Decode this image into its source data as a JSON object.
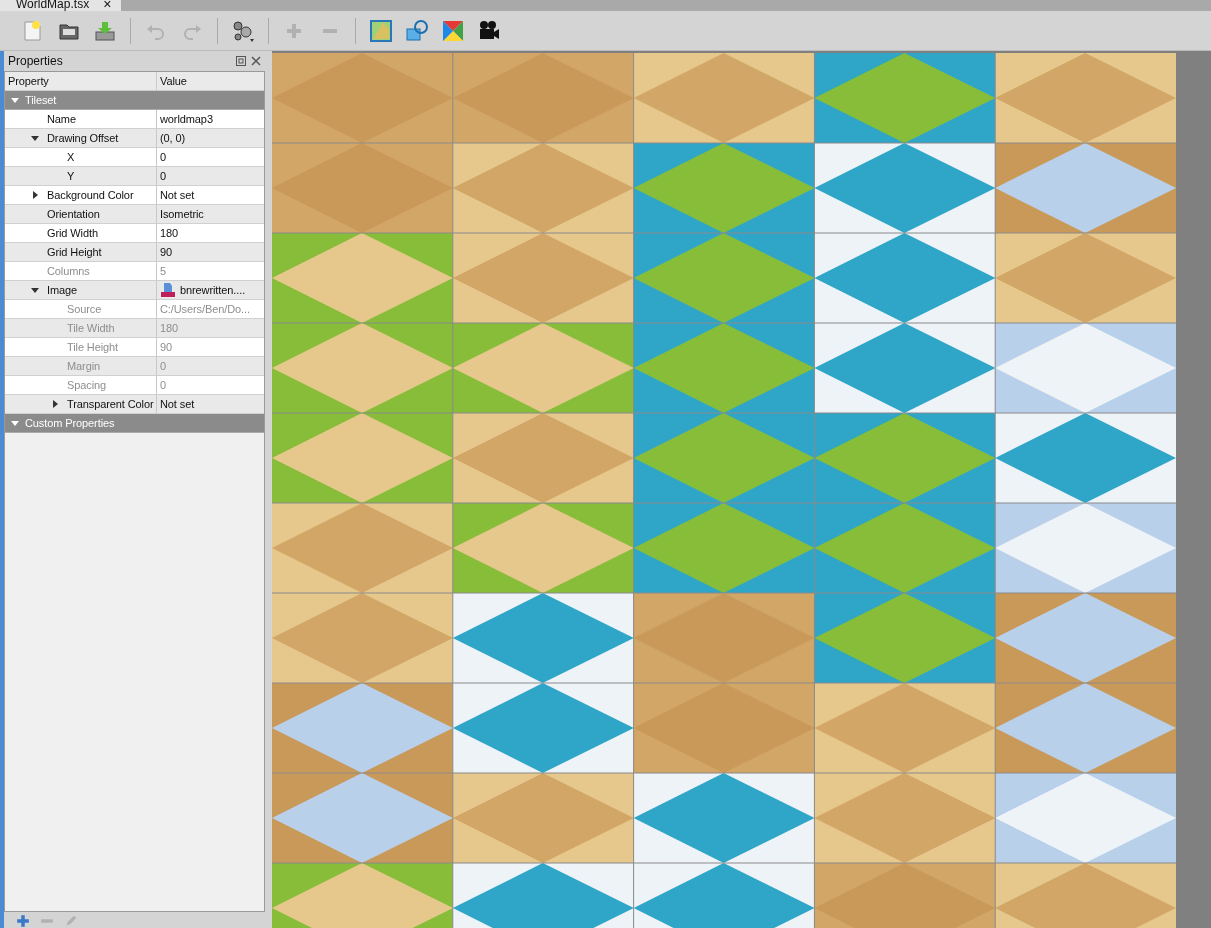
{
  "tab": {
    "title": "WorldMap.tsx",
    "close": "×"
  },
  "toolbar": [
    {
      "kind": "new",
      "disabled": false
    },
    {
      "kind": "open",
      "disabled": false
    },
    {
      "kind": "save",
      "disabled": false
    },
    {
      "kind": "undo",
      "disabled": true
    },
    {
      "kind": "redo",
      "disabled": true
    },
    {
      "kind": "gear",
      "disabled": false
    },
    {
      "kind": "add",
      "disabled": true
    },
    {
      "kind": "remove",
      "disabled": true
    },
    {
      "kind": "image",
      "disabled": false
    },
    {
      "kind": "shapes",
      "disabled": false
    },
    {
      "kind": "color",
      "disabled": false
    },
    {
      "kind": "camera",
      "disabled": false
    }
  ],
  "properties": {
    "title": "Properties",
    "columns": [
      "Property",
      "Value"
    ],
    "rows": [
      {
        "kind": "group",
        "label": "Tileset",
        "expanded": true,
        "children": [
          {
            "kind": "property",
            "label": "Name",
            "value": "worldmap3",
            "disabled": false
          },
          {
            "kind": "property",
            "label": "Drawing Offset",
            "value": "(0, 0)",
            "disabled": false,
            "expanded": true,
            "children": [
              {
                "kind": "property",
                "label": "X",
                "value": "0",
                "disabled": false
              },
              {
                "kind": "property",
                "label": "Y",
                "value": "0",
                "disabled": false
              }
            ]
          },
          {
            "kind": "property",
            "label": "Background Color",
            "value": "Not set",
            "disabled": false,
            "expanded": false
          },
          {
            "kind": "property",
            "label": "Orientation",
            "value": "Isometric",
            "disabled": false
          },
          {
            "kind": "property",
            "label": "Grid Width",
            "value": "180",
            "disabled": false
          },
          {
            "kind": "property",
            "label": "Grid Height",
            "value": "90",
            "disabled": false
          },
          {
            "kind": "property",
            "label": "Columns",
            "value": "5",
            "disabled": true
          },
          {
            "kind": "file",
            "label": "Image",
            "value": "bnrewritten....",
            "disabled": false,
            "expanded": true,
            "children": [
              {
                "kind": "property",
                "label": "Source",
                "value": "C:/Users/Ben/Do...",
                "disabled": true
              },
              {
                "kind": "property",
                "label": "Tile Width",
                "value": "180",
                "disabled": true
              },
              {
                "kind": "property",
                "label": "Tile Height",
                "value": "90",
                "disabled": true
              },
              {
                "kind": "property",
                "label": "Margin",
                "value": "0",
                "disabled": true
              },
              {
                "kind": "property",
                "label": "Spacing",
                "value": "0",
                "disabled": true
              },
              {
                "kind": "property",
                "label": "Transparent Color",
                "value": "Not set",
                "disabled": false,
                "expanded": false
              }
            ]
          }
        ]
      },
      {
        "kind": "group",
        "label": "Custom Properties",
        "expanded": true
      }
    ],
    "toolbar": [
      {
        "kind": "add",
        "disabled": false
      },
      {
        "kind": "remove",
        "disabled": true
      },
      {
        "kind": "edit",
        "disabled": true
      }
    ]
  }
}
